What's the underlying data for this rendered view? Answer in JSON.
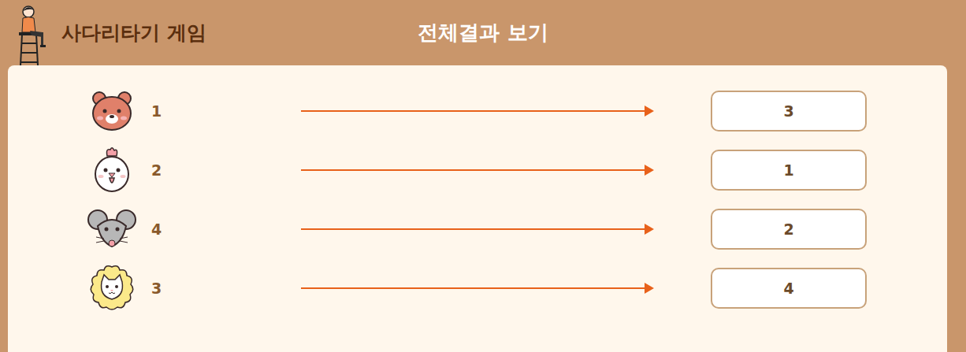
{
  "header": {
    "logo_text": "사다리타기 게임",
    "title": "전체결과 보기"
  },
  "rows": [
    {
      "label": "1",
      "result": "3"
    },
    {
      "label": "2",
      "result": "1"
    },
    {
      "label": "4",
      "result": "2"
    },
    {
      "label": "3",
      "result": "4"
    }
  ]
}
